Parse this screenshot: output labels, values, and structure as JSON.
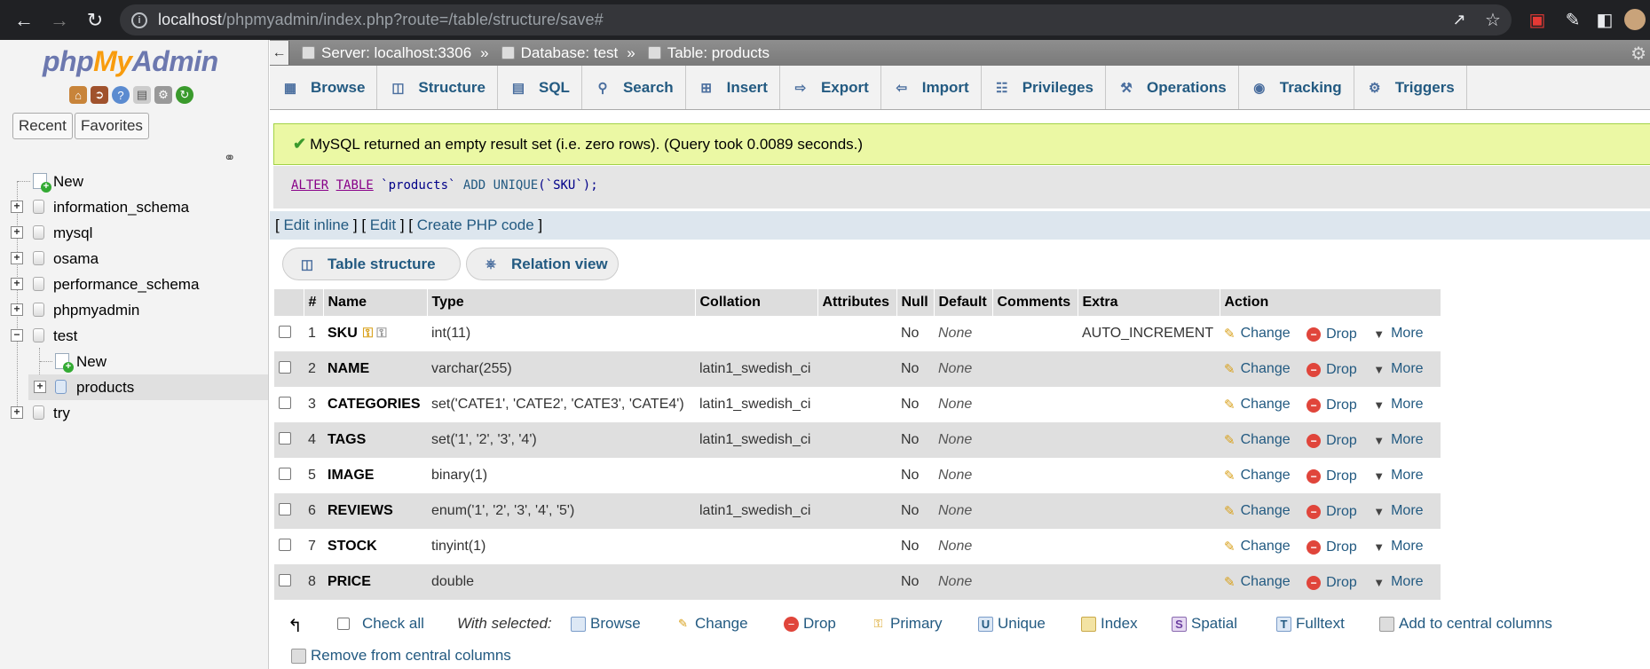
{
  "browser": {
    "url_host": "localhost",
    "url_path": "/phpmyadmin/index.php?route=/table/structure/save#"
  },
  "nav": {
    "logo": {
      "php": "php",
      "my": "My",
      "admin": "Admin"
    },
    "tabs": [
      "Recent",
      "Favorites"
    ],
    "tree": [
      {
        "label": "New",
        "kind": "new"
      },
      {
        "label": "information_schema",
        "kind": "db"
      },
      {
        "label": "mysql",
        "kind": "db"
      },
      {
        "label": "osama",
        "kind": "db"
      },
      {
        "label": "performance_schema",
        "kind": "db"
      },
      {
        "label": "phpmyadmin",
        "kind": "db"
      },
      {
        "label": "test",
        "kind": "db-open"
      },
      {
        "label": "New",
        "kind": "child-new"
      },
      {
        "label": "products",
        "kind": "child-table"
      },
      {
        "label": "try",
        "kind": "db"
      }
    ]
  },
  "breadcrumb": {
    "server": "Server: localhost:3306",
    "database": "Database: test",
    "table": "Table: products",
    "sep": "»"
  },
  "tabs": [
    "Browse",
    "Structure",
    "SQL",
    "Search",
    "Insert",
    "Export",
    "Import",
    "Privileges",
    "Operations",
    "Tracking",
    "Triggers"
  ],
  "message": "MySQL returned an empty result set (i.e. zero rows). (Query took 0.0089 seconds.)",
  "sql": {
    "alter": "ALTER",
    "table": "TABLE",
    "rest1": " `products` ",
    "add": "ADD",
    "unique": "UNIQUE",
    "rest2": "(`SKU`);"
  },
  "sql_links": {
    "edit_inline": "Edit inline",
    "edit": "Edit",
    "create_php": "Create PHP code"
  },
  "view_buttons": {
    "table_structure": "Table structure",
    "relation_view": "Relation view"
  },
  "columns": {
    "headers": [
      "",
      "#",
      "Name",
      "Type",
      "Collation",
      "Attributes",
      "Null",
      "Default",
      "Comments",
      "Extra",
      "Action"
    ],
    "rows": [
      {
        "num": "1",
        "name": "SKU",
        "type": "int(11)",
        "collation": "",
        "null": "No",
        "default": "None",
        "extra": "AUTO_INCREMENT"
      },
      {
        "num": "2",
        "name": "NAME",
        "type": "varchar(255)",
        "collation": "latin1_swedish_ci",
        "null": "No",
        "default": "None",
        "extra": ""
      },
      {
        "num": "3",
        "name": "CATEGORIES",
        "type": "set('CATE1', 'CATE2', 'CATE3', 'CATE4')",
        "collation": "latin1_swedish_ci",
        "null": "No",
        "default": "None",
        "extra": ""
      },
      {
        "num": "4",
        "name": "TAGS",
        "type": "set('1', '2', '3', '4')",
        "collation": "latin1_swedish_ci",
        "null": "No",
        "default": "None",
        "extra": ""
      },
      {
        "num": "5",
        "name": "IMAGE",
        "type": "binary(1)",
        "collation": "",
        "null": "No",
        "default": "None",
        "extra": ""
      },
      {
        "num": "6",
        "name": "REVIEWS",
        "type": "enum('1', '2', '3', '4', '5')",
        "collation": "latin1_swedish_ci",
        "null": "No",
        "default": "None",
        "extra": ""
      },
      {
        "num": "7",
        "name": "STOCK",
        "type": "tinyint(1)",
        "collation": "",
        "null": "No",
        "default": "None",
        "extra": ""
      },
      {
        "num": "8",
        "name": "PRICE",
        "type": "double",
        "collation": "",
        "null": "No",
        "default": "None",
        "extra": ""
      }
    ],
    "actions": {
      "change": "Change",
      "drop": "Drop",
      "more": "More"
    }
  },
  "bottom": {
    "check_all": "Check all",
    "with_selected": "With selected:",
    "browse": "Browse",
    "change": "Change",
    "drop": "Drop",
    "primary": "Primary",
    "unique": "Unique",
    "index": "Index",
    "spatial": "Spatial",
    "fulltext": "Fulltext",
    "add_central": "Add to central columns",
    "remove_central": "Remove from central columns"
  }
}
